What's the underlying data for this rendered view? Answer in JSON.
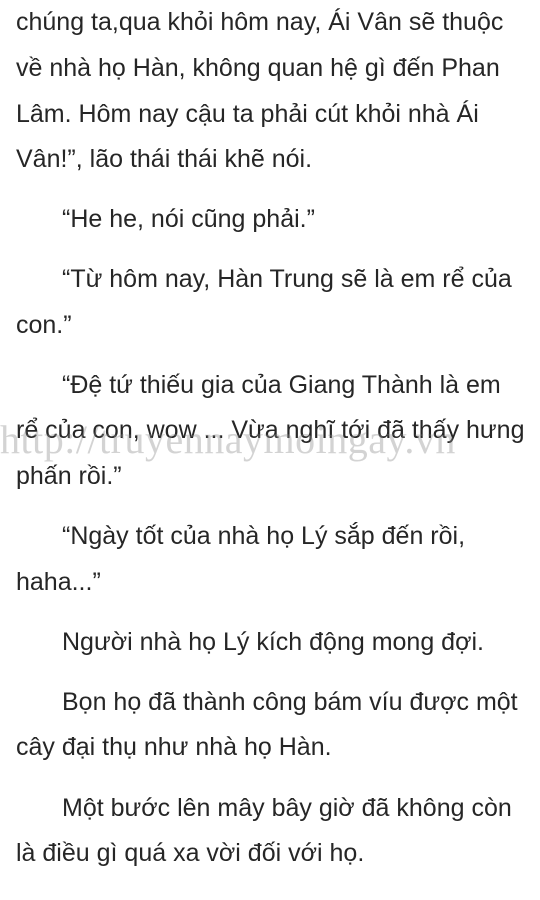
{
  "paragraphs": [
    {
      "lines": [
        "chúng ta,qua khỏi hôm nay, Ái Vân sẽ thuộc",
        "về nhà họ Hàn, không quan hệ gì đến Phan",
        "Lâm. Hôm nay cậu ta phải cút khỏi nhà Ái",
        "Vân!”, lão thái thái khẽ nói."
      ]
    },
    {
      "lines": [
        "“He he, nói cũng phải.”"
      ]
    },
    {
      "lines": [
        "“Từ hôm nay, Hàn Trung sẽ là em rể của",
        "con.”"
      ]
    },
    {
      "lines": [
        "“Đệ tứ thiếu gia của Giang Thành là em",
        "rể của con, wow ... Vừa nghĩ tới đã thấy hưng",
        "phấn rồi.”"
      ]
    },
    {
      "lines": [
        "“Ngày tốt của nhà họ Lý sắp đến rồi,",
        "haha...”"
      ]
    },
    {
      "lines": [
        "Người nhà họ Lý kích động mong đợi."
      ]
    },
    {
      "lines": [
        "Bọn họ đã thành công bám víu được một",
        "cây đại thụ như nhà họ Hàn."
      ]
    },
    {
      "lines": [
        "Một bước lên mây bây giờ đã không còn",
        "là điều gì quá xa vời đối với họ."
      ]
    }
  ],
  "watermark": "http://truyennaymoingay.vn"
}
